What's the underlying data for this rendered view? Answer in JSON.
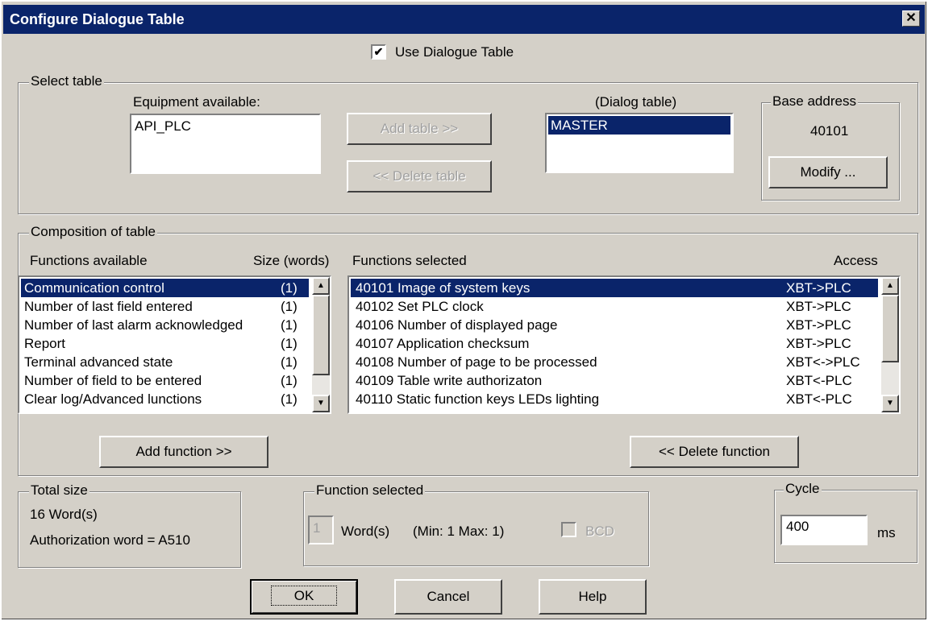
{
  "window": {
    "title": "Configure Dialogue Table",
    "close_glyph": "✕"
  },
  "use_table": {
    "label": "Use Dialogue Table",
    "checked": "✔"
  },
  "select_table": {
    "legend": "Select table",
    "equipment_label": "Equipment available:",
    "equipment_items": [
      "API_PLC"
    ],
    "add_table": "Add table >>",
    "delete_table": "<< Delete table",
    "dialog_label": "(Dialog table)",
    "dialog_items": [
      "MASTER"
    ],
    "base_legend": "Base address",
    "base_value": "40101",
    "modify": "Modify ..."
  },
  "composition": {
    "legend": "Composition of table",
    "available_header": "Functions available",
    "size_header": "Size (words)",
    "selected_header": "Functions selected",
    "access_header": "Access",
    "available": [
      {
        "name": "Communication control",
        "size": "(1)"
      },
      {
        "name": "Number of last field entered",
        "size": "(1)"
      },
      {
        "name": "Number of last alarm acknowledged",
        "size": "(1)"
      },
      {
        "name": "Report",
        "size": "(1)"
      },
      {
        "name": "Terminal advanced state",
        "size": "(1)"
      },
      {
        "name": "Number of field to be entered",
        "size": "(1)"
      },
      {
        "name": "Clear log/Advanced lunctions",
        "size": "(1)"
      }
    ],
    "selected": [
      {
        "name": "40101 Image of system keys",
        "access": "XBT->PLC"
      },
      {
        "name": "40102 Set PLC clock",
        "access": "XBT->PLC"
      },
      {
        "name": "40106 Number of displayed page",
        "access": "XBT->PLC"
      },
      {
        "name": "40107 Application checksum",
        "access": "XBT->PLC"
      },
      {
        "name": "40108 Number of page to be processed",
        "access": "XBT<->PLC"
      },
      {
        "name": "40109 Table write authorizaton",
        "access": "XBT<-PLC"
      },
      {
        "name": "40110 Static function keys LEDs lighting",
        "access": "XBT<-PLC"
      }
    ],
    "add_function": "Add function >>",
    "delete_function": "<< Delete function"
  },
  "total_size": {
    "legend": "Total size",
    "words": "16 Word(s)",
    "authorization": "Authorization word = A510"
  },
  "function_selected": {
    "legend": "Function selected",
    "value": "1",
    "words_label": "Word(s)",
    "range": "(Min: 1 Max: 1)",
    "bcd_label": "BCD"
  },
  "cycle": {
    "legend": "Cycle",
    "value": "400",
    "unit": "ms"
  },
  "buttons": {
    "ok": "OK",
    "cancel": "Cancel",
    "help": "Help"
  }
}
